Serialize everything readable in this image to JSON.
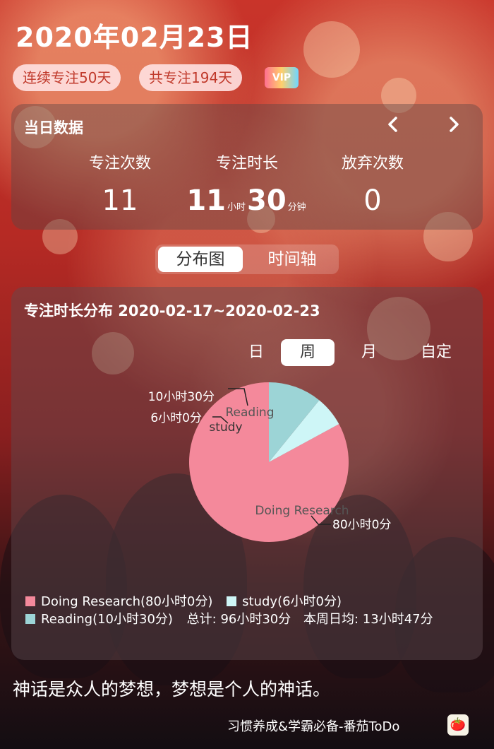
{
  "header": {
    "date": "2020年02月23日",
    "streak_chip": "连续专注50天",
    "total_chip": "共专注194天",
    "vip_badge": "VIP"
  },
  "daily": {
    "title": "当日数据",
    "prev_icon": "chevron-left-icon",
    "next_icon": "chevron-right-icon",
    "focus_count_label": "专注次数",
    "focus_count_value": "11",
    "focus_duration_label": "专注时长",
    "duration_hours": "11",
    "duration_hours_unit": "小时",
    "duration_minutes": "30",
    "duration_minutes_unit": "分钟",
    "abandon_label": "放弃次数",
    "abandon_value": "0"
  },
  "view_toggle": {
    "distribution": "分布图",
    "timeline": "时间轴",
    "selected": "分布图"
  },
  "distribution": {
    "title": "专注时长分布 2020-02-17~2020-02-23",
    "periods": [
      "日",
      "周",
      "月",
      "自定"
    ],
    "selected_period": "周",
    "total": "总计: 96小时30分",
    "weekly_avg": "本周日均: 13小时47分"
  },
  "chart_data": {
    "type": "pie",
    "title": "",
    "series": [
      {
        "name": "Doing Research",
        "value_minutes": 4800,
        "value_label": "80小时0分",
        "legend": "Doing Research(80小时0分)",
        "color": "#f4899b"
      },
      {
        "name": "study",
        "value_minutes": 360,
        "value_label": "6小时0分",
        "legend": "study(6小时0分)",
        "color": "#cef6f7"
      },
      {
        "name": "Reading",
        "value_minutes": 630,
        "value_label": "10小时30分",
        "legend": "Reading(10小时30分)",
        "color": "#9cd4d6"
      }
    ],
    "legend_position": "bottom"
  },
  "quote": "神话是众人的梦想，梦想是个人的神话。",
  "footer": {
    "app_slogan": "习惯养成&学霸必备-番茄ToDo",
    "app_icon": "tomato-icon"
  }
}
